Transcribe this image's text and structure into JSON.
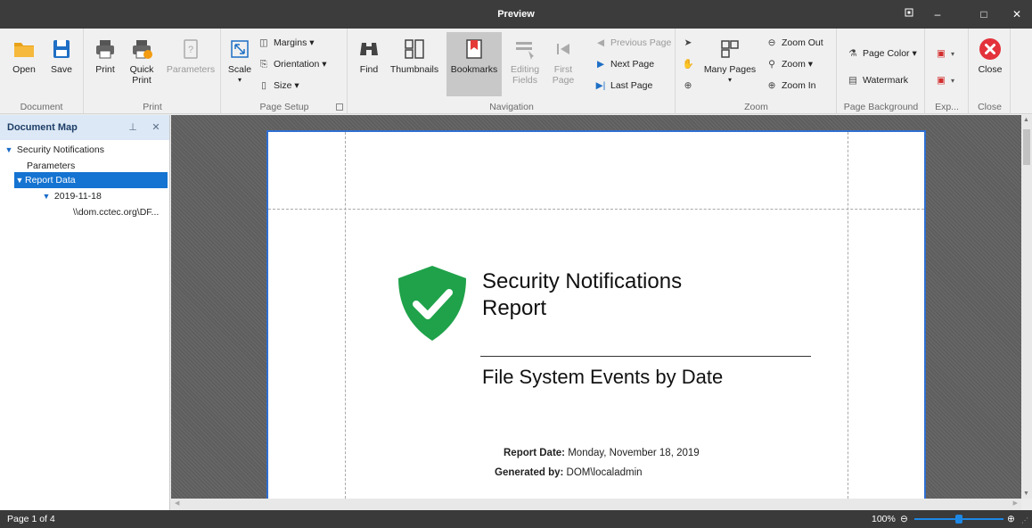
{
  "window": {
    "title": "Preview",
    "buttons": {
      "restore_icon": "restore-icon",
      "minimize": "–",
      "maximize": "□",
      "close": "✕"
    }
  },
  "ribbon": {
    "groups": {
      "document": "Document",
      "print": "Print",
      "page_setup": "Page Setup",
      "navigation": "Navigation",
      "zoom": "Zoom",
      "page_background": "Page Background",
      "export": "Exp...",
      "close": "Close"
    },
    "buttons": {
      "open": "Open",
      "save": "Save",
      "print": "Print",
      "quick_print": "Quick\nPrint",
      "parameters": "Parameters",
      "scale": "Scale",
      "margins": "Margins ▾",
      "orientation": "Orientation ▾",
      "size": "Size ▾",
      "find": "Find",
      "thumbnails": "Thumbnails",
      "bookmarks": "Bookmarks",
      "editing_fields": "Editing\nFields",
      "first_page": "First\nPage",
      "previous_page": "Previous Page",
      "next_page": "Next Page",
      "last_page": "Last Page",
      "many_pages": "Many Pages",
      "zoom_out": "Zoom Out",
      "zoom": "Zoom ▾",
      "zoom_in": "Zoom In",
      "page_color": "Page Color ▾",
      "watermark": "Watermark",
      "close": "Close"
    }
  },
  "document_map": {
    "title": "Document Map",
    "items": [
      {
        "label": "Security Notifications"
      },
      {
        "label": "Parameters"
      },
      {
        "label": "Report Data"
      },
      {
        "label": "2019-11-18"
      },
      {
        "label": "\\\\dom.cctec.org\\DF..."
      }
    ]
  },
  "report": {
    "title_line1": "Security Notifications",
    "title_line2": "Report",
    "subtitle": "File System Events by Date",
    "report_date_label": "Report Date:",
    "report_date_value": "Monday, November 18, 2019",
    "generated_by_label": "Generated by:",
    "generated_by_value": "DOM\\localadmin"
  },
  "status": {
    "page": "Page 1 of 4",
    "zoom": "100%",
    "zoom_slider_fraction": 0.5
  },
  "colors": {
    "accent": "#1573d1",
    "shield": "#1fa24a",
    "close_red": "#e3323b",
    "export_red": "#d32f2f"
  }
}
